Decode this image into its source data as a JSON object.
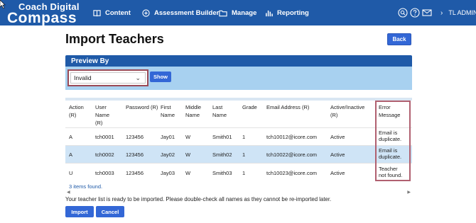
{
  "nav": {
    "logo_line1": "Coach Digital",
    "logo_line2": "Compass",
    "items": [
      {
        "label": "Content",
        "icon": "book-icon"
      },
      {
        "label": "Assessment Builder",
        "icon": "plus-circle-icon"
      },
      {
        "label": "Manage",
        "icon": "folder-icon"
      },
      {
        "label": "Reporting",
        "icon": "bar-chart-icon"
      }
    ],
    "user": "TL ADMIN"
  },
  "page": {
    "title": "Import Teachers",
    "back_label": "Back"
  },
  "preview": {
    "heading": "Preview By",
    "selected": "Invalid",
    "show_label": "Show"
  },
  "table": {
    "headers": [
      [
        "Action",
        "(R)"
      ],
      [
        "User",
        "Name",
        "(R)"
      ],
      [
        "Password (R)"
      ],
      [
        "First",
        "Name"
      ],
      [
        "Middle",
        "Name"
      ],
      [
        "Last",
        "Name"
      ],
      [
        "Grade"
      ],
      [
        "Email Address (R)"
      ],
      [
        "Active/Inactive",
        "(R)"
      ],
      [
        "Error",
        "Message"
      ]
    ],
    "rows": [
      {
        "action": "A",
        "user": "tch0001",
        "password": "123456",
        "first": "Jay01",
        "middle": "W",
        "last": "Smith01",
        "grade": "1",
        "email": "tch10012@icore.com",
        "active": "Active",
        "err1": "Email is",
        "err2": "duplicate."
      },
      {
        "action": "A",
        "user": "tch0002",
        "password": "123456",
        "first": "Jay02",
        "middle": "W",
        "last": "Smith02",
        "grade": "1",
        "email": "tch10022@icore.com",
        "active": "Active",
        "err1": "Email is",
        "err2": "duplicate."
      },
      {
        "action": "U",
        "user": "tch0003",
        "password": "123456",
        "first": "Jay03",
        "middle": "W",
        "last": "Smith03",
        "grade": "1",
        "email": "tch10023@icore.com",
        "active": "Active",
        "err1": "Teacher",
        "err2": "not found."
      }
    ],
    "count_text": "3 items found."
  },
  "note": "Your teacher list is ready to be imported. Please double-check all names as they cannot be re-imported later.",
  "buttons": {
    "import_label": "Import",
    "cancel_label": "Cancel"
  },
  "colors": {
    "nav": "#1f5aa8",
    "button": "#3367d6",
    "panel": "#a8d1f0",
    "selected_row": "#cfe4f6",
    "highlight_border": "#b06070"
  }
}
